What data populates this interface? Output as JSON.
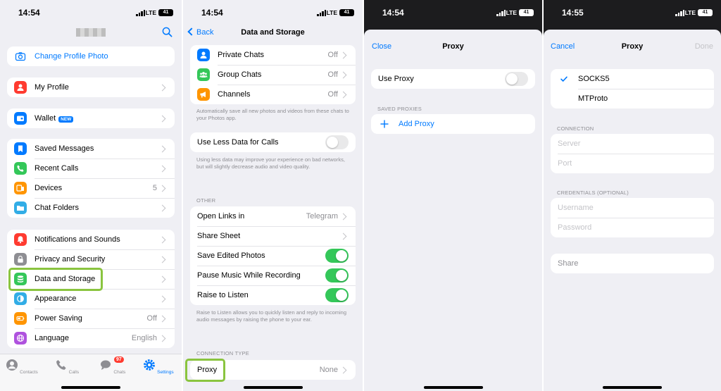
{
  "screens": {
    "settings": {
      "status": {
        "time": "14:54",
        "network": "LTE",
        "battery": "41"
      },
      "change_photo": "Change Profile Photo",
      "my_profile": "My Profile",
      "wallet": {
        "label": "Wallet",
        "badge": "NEW"
      },
      "group_a": [
        {
          "label": "Saved Messages",
          "value": ""
        },
        {
          "label": "Recent Calls",
          "value": ""
        },
        {
          "label": "Devices",
          "value": "5"
        },
        {
          "label": "Chat Folders",
          "value": ""
        }
      ],
      "group_b": [
        {
          "label": "Notifications and Sounds",
          "value": ""
        },
        {
          "label": "Privacy and Security",
          "value": ""
        },
        {
          "label": "Data and Storage",
          "value": ""
        },
        {
          "label": "Appearance",
          "value": ""
        },
        {
          "label": "Power Saving",
          "value": "Off"
        },
        {
          "label": "Language",
          "value": "English"
        }
      ],
      "tabs": [
        {
          "label": "Contacts"
        },
        {
          "label": "Calls"
        },
        {
          "label": "Chats",
          "badge": "97"
        },
        {
          "label": "Settings"
        }
      ]
    },
    "data_storage": {
      "status": {
        "time": "14:54",
        "network": "LTE",
        "battery": "41"
      },
      "back": "Back",
      "title": "Data and Storage",
      "autosave": [
        {
          "label": "Private Chats",
          "value": "Off"
        },
        {
          "label": "Group Chats",
          "value": "Off"
        },
        {
          "label": "Channels",
          "value": "Off"
        }
      ],
      "autosave_caption": "Automatically save all new photos and videos from these chats to your Photos app.",
      "less_data": "Use Less Data for Calls",
      "less_data_caption": "Using less data may improve your experience on bad networks, but will slightly decrease audio and video quality.",
      "other_header": "OTHER",
      "other": [
        {
          "label": "Open Links in",
          "value": "Telegram",
          "control": "chevron"
        },
        {
          "label": "Share Sheet",
          "value": "",
          "control": "chevron"
        },
        {
          "label": "Save Edited Photos",
          "value": "",
          "control": "on"
        },
        {
          "label": "Pause Music While Recording",
          "value": "",
          "control": "on"
        },
        {
          "label": "Raise to Listen",
          "value": "",
          "control": "on"
        }
      ],
      "raise_caption": "Raise to Listen allows you to quickly listen and reply to incoming audio messages by raising the phone to your ear.",
      "connection_header": "CONNECTION TYPE",
      "proxy": {
        "label": "Proxy",
        "value": "None"
      }
    },
    "proxy": {
      "status": {
        "time": "14:54",
        "network": "LTE",
        "battery": "41"
      },
      "close": "Close",
      "title": "Proxy",
      "use_proxy": "Use Proxy",
      "saved_header": "SAVED PROXIES",
      "add_proxy": "Add Proxy"
    },
    "proxy_edit": {
      "status": {
        "time": "14:55",
        "network": "LTE",
        "battery": "41"
      },
      "cancel": "Cancel",
      "title": "Proxy",
      "done": "Done",
      "types": [
        "SOCKS5",
        "MTProto"
      ],
      "connection_header": "CONNECTION",
      "server_placeholder": "Server",
      "port_placeholder": "Port",
      "credentials_header": "CREDENTIALS (OPTIONAL)",
      "username_placeholder": "Username",
      "password_placeholder": "Password",
      "share": "Share"
    }
  },
  "colors": {
    "accent": "#007aff",
    "highlight": "#8ac43f",
    "toggle_on": "#34c759",
    "background": "#efeff4"
  }
}
